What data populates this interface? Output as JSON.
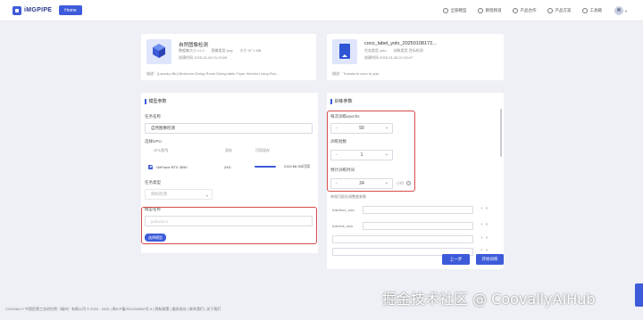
{
  "header": {
    "logo_text": "iMGPIPE",
    "home_label": "Home",
    "nav": [
      "全部模型",
      "教程频道",
      "产品合作",
      "产品方案",
      "工具箱"
    ]
  },
  "models": [
    {
      "title": "自然图像检测",
      "meta": [
        "数据集大小 v1.0",
        "图像类型 png",
        "大小 97.1 MB"
      ],
      "time": "创建时间 2025-01-08 21:23:00",
      "desc": "描述：[Laundry Bin] Bedroom Dining Room Dining table Foyer Kitchen Living Roo..."
    },
    {
      "title": "coco_label_yolo_20250108172...",
      "meta": [
        "任务类型 yolo",
        "训练类型 目标检测"
      ],
      "time": "创建时间 2025-01-08 21:00:47",
      "desc": "描述：Transform coco to yolo"
    }
  ],
  "left_panel": {
    "title": "模型参数",
    "task_name_label": "任务名称",
    "task_name_value": "自然图像检测",
    "gpu_label": "选择GPU",
    "gpu_headers": [
      "GPU型号",
      "显存",
      "可用显存"
    ],
    "gpu_row": {
      "name": "GeForce RTX 3090",
      "mem": "24G",
      "available": "2119.66 GB可用",
      "available_fraction": 0.8
    },
    "task_type_label": "任务类型",
    "task_type_value": "目标检测",
    "model_name_label": "模型名称",
    "model_name_placeholder": "yolov11-s",
    "select_model_label": "选择模型"
  },
  "right_panel": {
    "title": "训练参数",
    "epochs_label": "每次训练epochs",
    "epochs_value": "50",
    "batch_label": "训练批数",
    "batch_value": "1",
    "time_label": "预计训练时间",
    "time_value": "24",
    "time_unit": "小时",
    "hyper_label": "单独可报名调整超参数",
    "param_rows": [
      "train/box_loss",
      "train/cls_loss",
      "",
      "",
      ""
    ],
    "prev_label": "上一步",
    "start_label": "开始训练"
  },
  "footer": "COOVALLY 中国民营工业研究院（福州）有限公司 © 2020 - 2025 | 闽ICP备2021004560号-5 | 隐私政策 | 服务协议 | 联系我们 | 关于我们",
  "watermark": "掘金技术社区 @ CoovallyAIHub",
  "colors": {
    "accent": "#3d5bd9",
    "highlight": "#d94b4b"
  }
}
